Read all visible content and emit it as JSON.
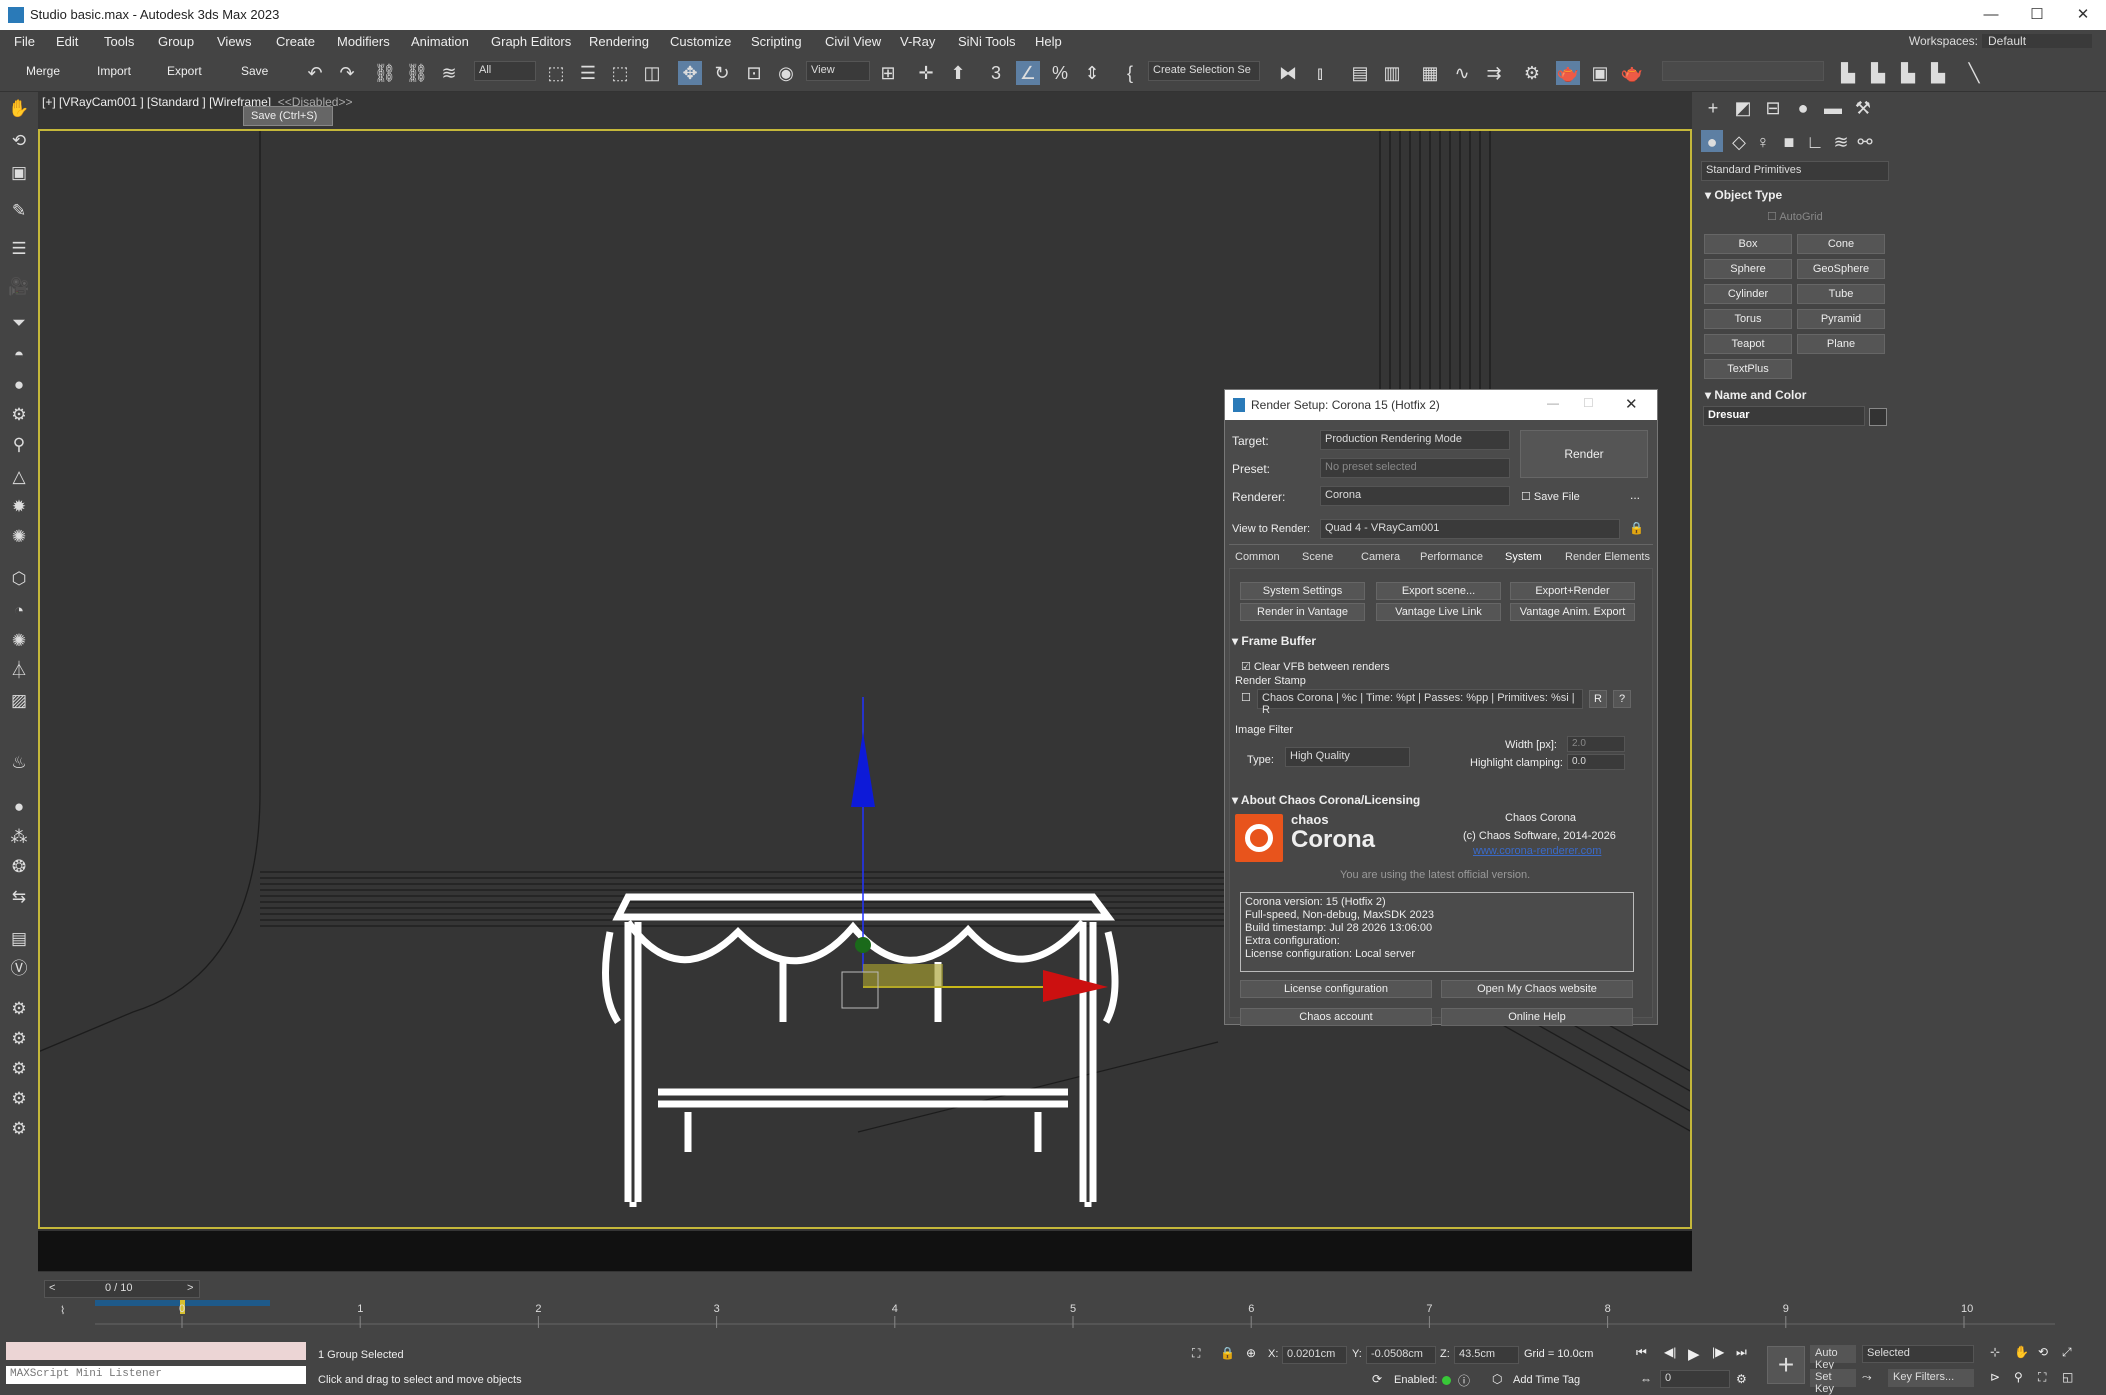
{
  "window": {
    "title": "Studio basic.max - Autodesk 3ds Max 2023",
    "min": "—",
    "max": "☐",
    "close": "✕"
  },
  "menu": [
    "File",
    "Edit",
    "Tools",
    "Group",
    "Views",
    "Create",
    "Modifiers",
    "Animation",
    "Graph Editors",
    "Rendering",
    "Customize",
    "Scripting",
    "Civil View",
    "V-Ray",
    "SiNi Tools",
    "Help"
  ],
  "workspace": {
    "label": "Workspaces:",
    "value": "Default"
  },
  "toolbar": {
    "merge": "Merge",
    "import": "Import",
    "export": "Export",
    "save": "Save",
    "filter": "All",
    "refcoord": "View",
    "selset": "Create Selection Se"
  },
  "viewport": {
    "label": "[+] [VRayCam001 ] [Standard ] [Wireframe]",
    "disabled": "<<Disabled>>",
    "tooltip": "Save   (Ctrl+S)"
  },
  "cmdpanel": {
    "category": "Standard Primitives",
    "object_type": "Object Type",
    "autogrid": "AutoGrid",
    "buttons": [
      "Box",
      "Cone",
      "Sphere",
      "GeoSphere",
      "Cylinder",
      "Tube",
      "Torus",
      "Pyramid",
      "Teapot",
      "Plane",
      "TextPlus"
    ],
    "name_color": "Name and Color",
    "object_name": "Dresuar"
  },
  "render_setup": {
    "title": "Render Setup: Corona 15 (Hotfix 2)",
    "target_label": "Target:",
    "target": "Production Rendering Mode",
    "preset_label": "Preset:",
    "preset": "No preset selected",
    "renderer_label": "Renderer:",
    "renderer": "Corona",
    "save_file": "Save File",
    "more": "...",
    "view_label": "View to Render:",
    "view": "Quad 4 - VRayCam001",
    "render_btn": "Render",
    "tabs": [
      "Common",
      "Scene",
      "Camera",
      "Performance",
      "System",
      "Render Elements"
    ],
    "sys_buttons": [
      "System Settings",
      "Export scene...",
      "Export+Render",
      "Render in Vantage",
      "Vantage Live Link",
      "Vantage Anim. Export"
    ],
    "frame_buffer": "Frame Buffer",
    "clear_vfb": "Clear VFB between renders",
    "render_stamp": "Render Stamp",
    "stamp_text": "Chaos Corona | %c | Time: %pt | Passes: %pp | Primitives: %si | R",
    "stamp_r": "R",
    "stamp_q": "?",
    "image_filter": "Image Filter",
    "type_label": "Type:",
    "type": "High Quality",
    "width_label": "Width [px]:",
    "width": "2.0",
    "highlight_label": "Highlight clamping:",
    "highlight": "0.0",
    "about": "About Chaos Corona/Licensing",
    "logo_top": "chaos",
    "logo_bottom": "Corona",
    "about_name": "Chaos Corona",
    "about_copy": "(c) Chaos Software, 2014-2026",
    "about_link": "www.corona-renderer.com",
    "latest": "You are using the latest official version.",
    "version_lines": [
      "Corona version: 15 (Hotfix 2)",
      "Full-speed, Non-debug, MaxSDK 2023",
      "Build timestamp: Jul 28 2026 13:06:00",
      "Extra configuration:",
      "License configuration: Local server"
    ],
    "bottom_buttons": [
      "License configuration",
      "Open My Chaos website",
      "Chaos account",
      "Online Help"
    ]
  },
  "timeline": {
    "frame": "0 / 10",
    "ticks": [
      "0",
      "1",
      "2",
      "3",
      "4",
      "5",
      "6",
      "7",
      "8",
      "9",
      "10"
    ]
  },
  "status": {
    "selected": "1 Group Selected",
    "hint": "Click and drag to select and move objects",
    "listener": "MAXScript Mini Listener",
    "x_label": "X:",
    "x": "0.0201cm",
    "y_label": "Y:",
    "y": "-0.0508cm",
    "z_label": "Z:",
    "z": "43.5cm",
    "grid": "Grid = 10.0cm",
    "enabled": "Enabled:",
    "add_time_tag": "Add Time Tag",
    "autokey": "Auto Key",
    "selected_dd": "Selected",
    "setkey": "Set Key",
    "keyfilters": "Key Filters...",
    "frame_field": "0"
  }
}
